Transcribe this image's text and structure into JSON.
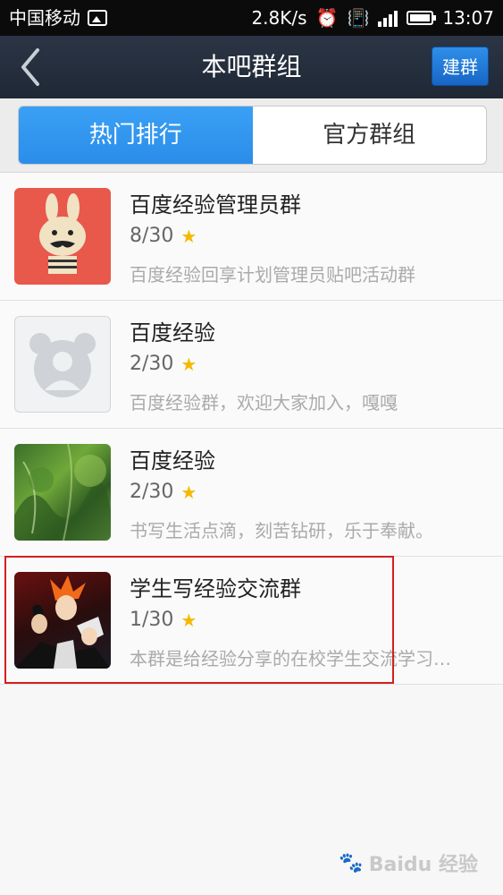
{
  "status_bar": {
    "carrier": "中国移动",
    "speed": "2.8K/s",
    "time": "13:07"
  },
  "header": {
    "title": "本吧群组",
    "create_label": "建群"
  },
  "tabs": [
    {
      "label": "热门排行",
      "active": true
    },
    {
      "label": "官方群组",
      "active": false
    }
  ],
  "groups": [
    {
      "name": "百度经验管理员群",
      "count": "8/30",
      "desc": "百度经验回享计划管理员贴吧活动群",
      "avatar": "rabbit-avatar"
    },
    {
      "name": "百度经验",
      "count": "2/30",
      "desc": "百度经验群，欢迎大家加入，嘎嘎",
      "avatar": "default-avatar"
    },
    {
      "name": "百度经验",
      "count": "2/30",
      "desc": "书写生活点滴，刻苦钻研，乐于奉献。",
      "avatar": "forest-photo"
    },
    {
      "name": "学生写经验交流群",
      "count": "1/30",
      "desc": "本群是给经验分享的在校学生交流学习…",
      "avatar": "anime-photo"
    }
  ],
  "watermark": {
    "text": "Baidu 经验"
  },
  "colors": {
    "accent": "#2b8de9",
    "highlight": "#d32020",
    "star": "#f5b800"
  }
}
